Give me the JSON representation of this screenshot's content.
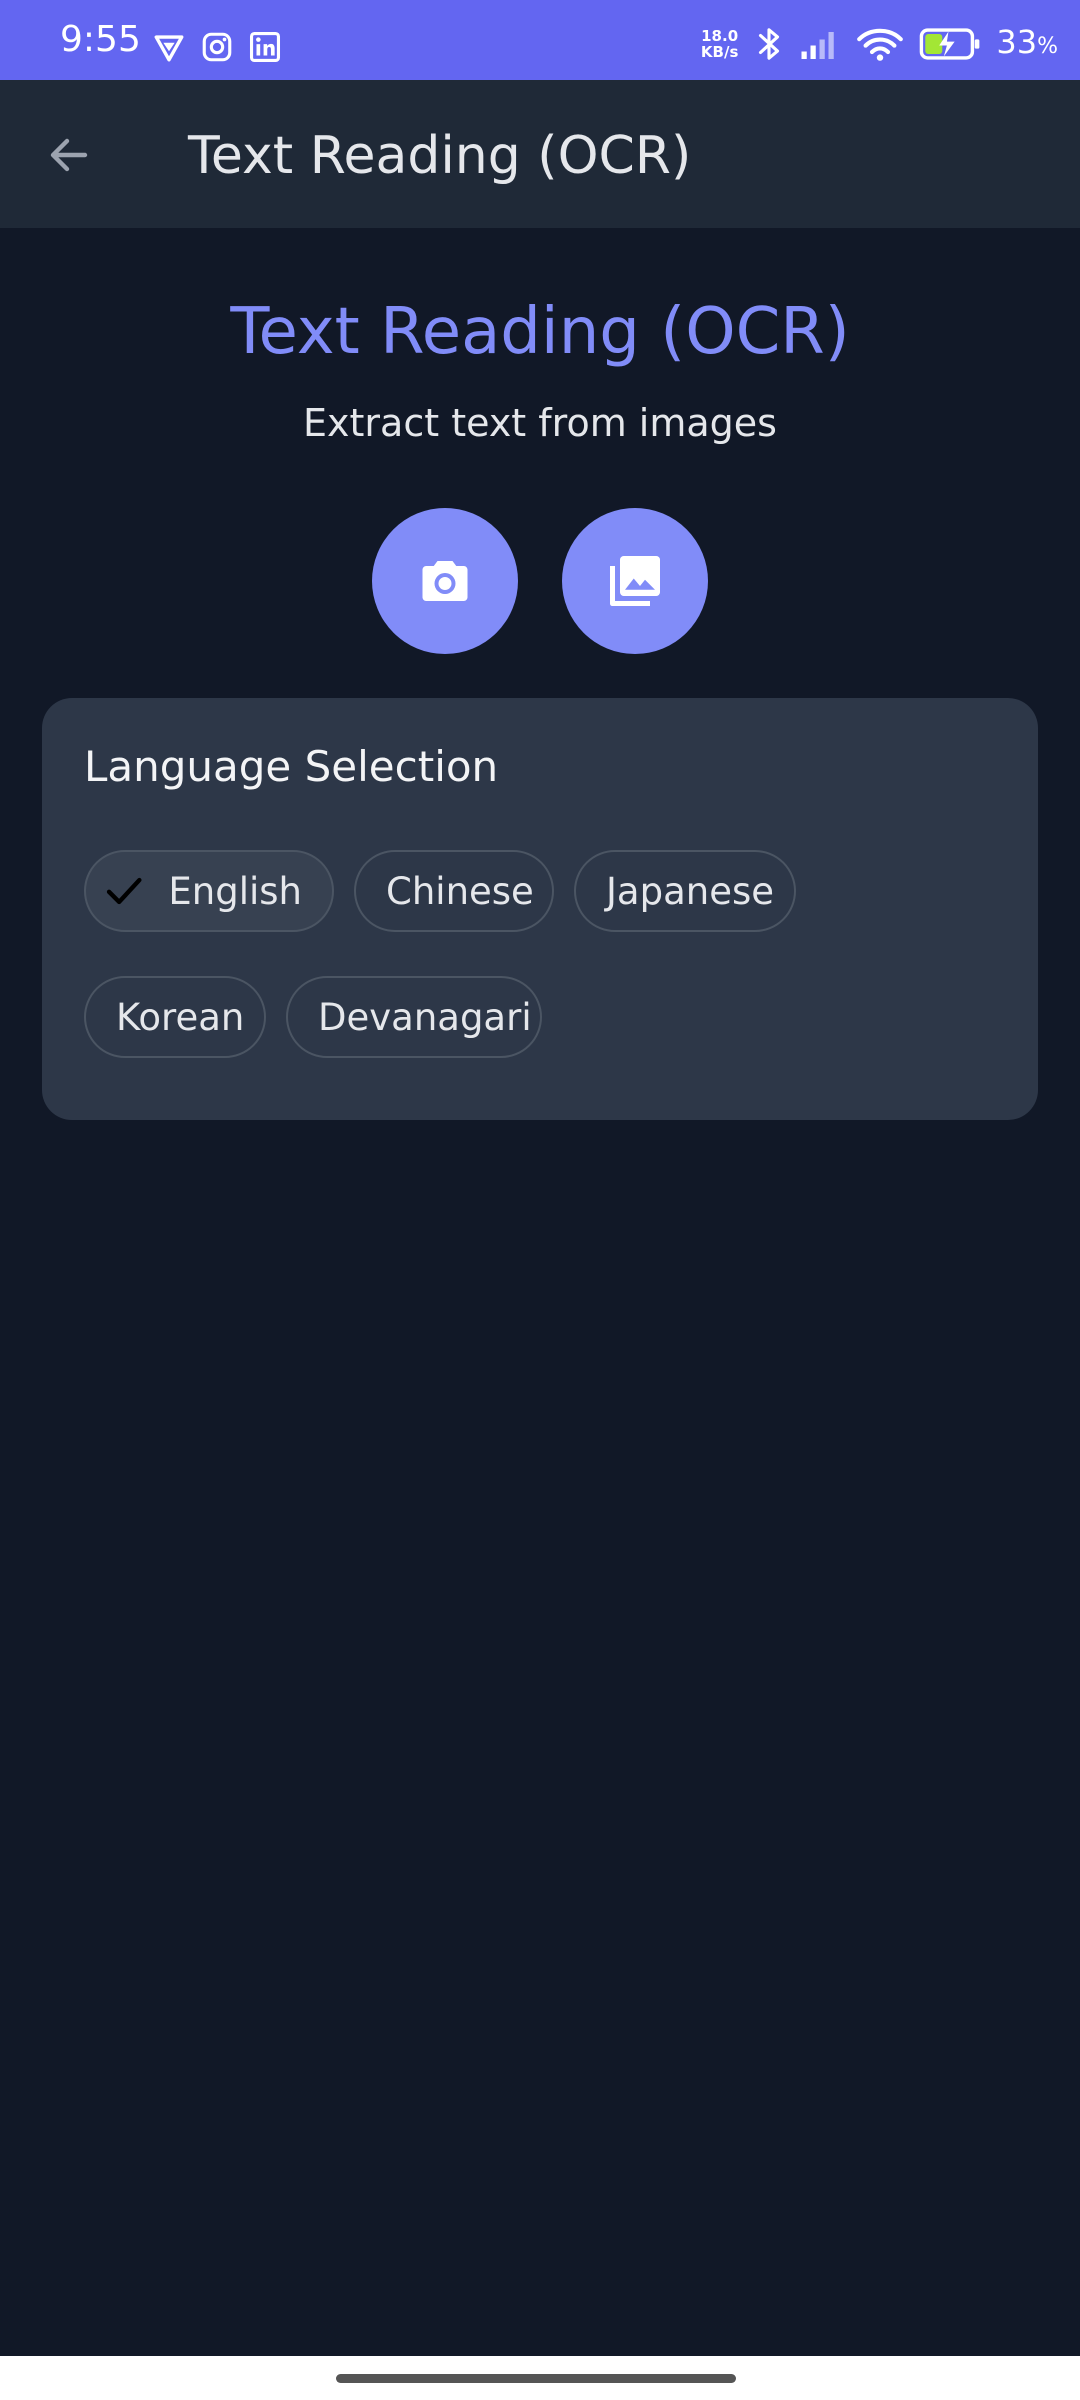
{
  "status_bar": {
    "time": "9:55",
    "net_speed_value": "18.0",
    "net_speed_unit": "KB/s",
    "battery_percent": "33",
    "battery_unit": "%",
    "left_icons": [
      "vpn-shield-icon",
      "instagram-icon",
      "linkedin-icon"
    ],
    "right_icons": [
      "bluetooth-icon",
      "cell-signal-icon",
      "wifi-icon",
      "battery-charging-icon"
    ],
    "background": "#6366f1"
  },
  "app_bar": {
    "title": "Text Reading (OCR)",
    "back_icon": "arrow-left-icon",
    "background": "#1f2937"
  },
  "header": {
    "title": "Text Reading (OCR)",
    "subtitle": "Extract text from images",
    "accent": "#818cf8"
  },
  "actions": [
    {
      "name": "camera-button",
      "icon": "camera-icon"
    },
    {
      "name": "gallery-button",
      "icon": "photo-library-icon"
    }
  ],
  "language_selection": {
    "title": "Language Selection",
    "options": [
      {
        "label": "English",
        "selected": true
      },
      {
        "label": "Chinese",
        "selected": false
      },
      {
        "label": "Japanese",
        "selected": false
      },
      {
        "label": "Korean",
        "selected": false
      },
      {
        "label": "Devanagari",
        "selected": false
      }
    ],
    "card_background": "#2d3748"
  },
  "colors": {
    "page_background": "#111827",
    "chip_border": "#4b5563"
  }
}
